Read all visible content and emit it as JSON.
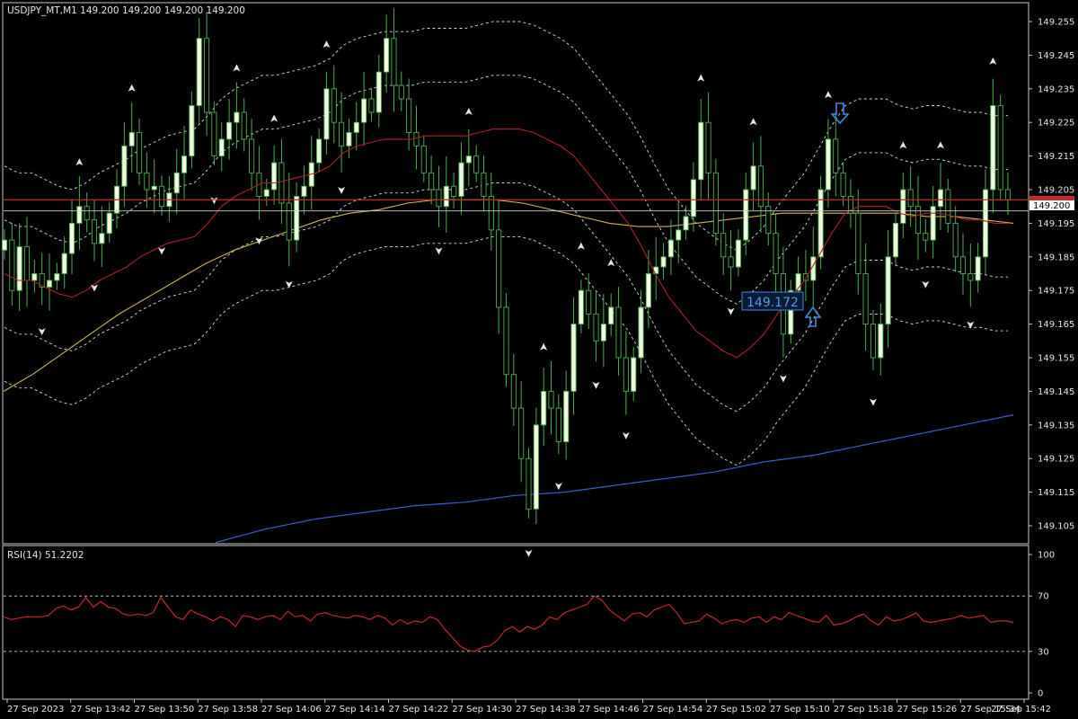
{
  "header": {
    "symbol_line": "USDJPY_MT,M1  149.200 149.200 149.200 149.200",
    "rsi_line": "RSI(14) 51.2202"
  },
  "price_tags": {
    "current": "149.200",
    "annotation": "149.172"
  },
  "colors": {
    "background": "#000000",
    "bull_body": "#f2fbe0",
    "wick": "#4caf50",
    "bands": "#dddddd",
    "ma_fast": "#b22222",
    "ma_mid": "#d4b25a",
    "ma_slow": "#3a5fcd",
    "rsi": "#c62828",
    "signal_arrow": "#3d8de0",
    "price_line_red": "#c62828",
    "price_line_white": "#cfcfcf"
  },
  "chart_data": [
    {
      "type": "candlestick",
      "symbol": "USDJPY_MT",
      "timeframe": "M1",
      "ylim": [
        149.1,
        149.26
      ],
      "y_ticks": [
        "149.255",
        "149.245",
        "149.235",
        "149.225",
        "149.215",
        "149.205",
        "149.195",
        "149.185",
        "149.175",
        "149.165",
        "149.155",
        "149.145",
        "149.135",
        "149.125",
        "149.115",
        "149.105"
      ],
      "x_ticks": [
        "27 Sep 2023",
        "27 Sep 13:42",
        "27 Sep 13:50",
        "27 Sep 13:58",
        "27 Sep 14:06",
        "27 Sep 14:14",
        "27 Sep 14:22",
        "27 Sep 14:30",
        "27 Sep 14:38",
        "27 Sep 14:46",
        "27 Sep 14:54",
        "27 Sep 15:02",
        "27 Sep 15:10",
        "27 Sep 15:18",
        "27 Sep 15:26",
        "27 Sep 15:34",
        "27 Sep 15:42"
      ],
      "close": [
        149.19,
        149.175,
        149.188,
        149.178,
        149.18,
        149.176,
        149.178,
        149.18,
        149.186,
        149.195,
        149.2,
        149.196,
        149.189,
        149.192,
        149.198,
        149.206,
        149.218,
        149.222,
        149.21,
        149.205,
        149.206,
        149.2,
        149.204,
        149.21,
        149.215,
        149.23,
        149.25,
        149.228,
        149.215,
        149.22,
        149.225,
        149.228,
        149.22,
        149.21,
        149.203,
        149.205,
        149.213,
        149.201,
        149.19,
        149.203,
        149.206,
        149.213,
        149.22,
        149.235,
        149.225,
        149.218,
        149.222,
        149.225,
        149.232,
        149.228,
        149.24,
        149.25,
        149.236,
        149.232,
        149.222,
        149.218,
        149.21,
        149.205,
        149.2,
        149.206,
        149.203,
        149.213,
        149.215,
        149.21,
        149.203,
        149.193,
        149.17,
        149.15,
        149.14,
        149.125,
        149.11,
        149.135,
        149.145,
        149.14,
        149.13,
        149.145,
        149.165,
        149.175,
        149.168,
        149.16,
        149.165,
        149.17,
        149.155,
        149.145,
        149.155,
        149.17,
        149.18,
        149.182,
        149.185,
        149.19,
        149.193,
        149.197,
        149.208,
        149.225,
        149.21,
        149.192,
        149.185,
        149.182,
        149.19,
        149.205,
        149.212,
        149.2,
        149.192,
        149.18,
        149.162,
        149.175,
        149.18,
        149.178,
        149.185,
        149.205,
        149.22,
        149.21,
        149.203,
        149.198,
        149.18,
        149.165,
        149.155,
        149.165,
        149.185,
        149.195,
        149.205,
        149.2,
        149.192,
        149.19,
        149.2,
        149.205,
        149.195,
        149.185,
        149.18,
        149.178,
        149.185,
        149.205,
        149.23,
        149.205,
        149.202
      ],
      "ma_fast": [
        149.18,
        149.178,
        149.178,
        149.176,
        149.174,
        149.173,
        149.175,
        149.178,
        149.18,
        149.182,
        149.185,
        149.187,
        149.189,
        149.19,
        149.191,
        149.195,
        149.2,
        149.203,
        149.205,
        149.207,
        149.207,
        149.208,
        149.209,
        149.21,
        149.212,
        149.216,
        149.218,
        149.219,
        149.22,
        149.22,
        149.22,
        149.221,
        149.221,
        149.221,
        149.221,
        149.222,
        149.223,
        149.223,
        149.223,
        149.222,
        149.22,
        149.218,
        149.215,
        149.21,
        149.205,
        149.2,
        149.195,
        149.188,
        149.18,
        149.173,
        149.168,
        149.163,
        149.16,
        149.157,
        149.155,
        149.158,
        149.162,
        149.168,
        149.173,
        149.178,
        149.185,
        149.192,
        149.198,
        149.2,
        149.2,
        149.2,
        149.198,
        149.197,
        149.198,
        149.198,
        149.197,
        149.196,
        149.196,
        149.195,
        149.195
      ],
      "ma_mid": [
        149.145,
        149.15,
        149.156,
        149.162,
        149.168,
        149.173,
        149.178,
        149.183,
        149.187,
        149.19,
        149.193,
        149.196,
        149.198,
        149.199,
        149.201,
        149.202,
        149.202,
        149.202,
        149.201,
        149.199,
        149.197,
        149.195,
        149.194,
        149.194,
        149.195,
        149.196,
        149.197,
        149.198,
        149.198,
        149.198,
        149.198,
        149.198,
        149.197,
        149.197,
        149.196,
        149.195
      ],
      "ma_slow": [
        149.1,
        149.104,
        149.107,
        149.109,
        149.111,
        149.112,
        149.114,
        149.115,
        149.117,
        149.119,
        149.121,
        149.124,
        149.126,
        149.129,
        149.132,
        149.135,
        149.138
      ],
      "rsi_period": 14,
      "rsi_last": 51.2202,
      "rsi_levels": [
        30,
        70
      ],
      "rsi_ylim": [
        0,
        100
      ],
      "rsi_ticks": [
        "100",
        "70",
        "30",
        "0"
      ],
      "rsi": [
        55,
        53,
        54,
        55,
        55,
        55,
        56,
        61,
        63,
        60,
        62,
        69,
        62,
        66,
        62,
        61,
        57,
        56,
        57,
        56,
        58,
        69,
        62,
        55,
        53,
        60,
        57,
        55,
        52,
        55,
        53,
        48,
        56,
        55,
        53,
        55,
        56,
        53,
        59,
        55,
        56,
        52,
        57,
        58,
        56,
        55,
        54,
        56,
        55,
        53,
        56,
        54,
        49,
        53,
        50,
        52,
        51,
        55,
        53,
        46,
        40,
        34,
        31,
        30,
        33,
        34,
        38,
        45,
        48,
        44,
        48,
        46,
        49,
        55,
        53,
        58,
        60,
        62,
        64,
        70,
        67,
        60,
        56,
        52,
        57,
        58,
        55,
        60,
        62,
        64,
        58,
        50,
        51,
        52,
        57,
        54,
        50,
        52,
        53,
        51,
        54,
        55,
        51,
        55,
        53,
        58,
        56,
        54,
        52,
        51,
        56,
        49,
        50,
        52,
        55,
        57,
        52,
        49,
        55,
        52,
        53,
        55,
        58,
        52,
        51,
        52,
        53,
        54,
        56,
        54,
        55,
        56,
        51,
        52,
        52,
        51
      ]
    }
  ]
}
